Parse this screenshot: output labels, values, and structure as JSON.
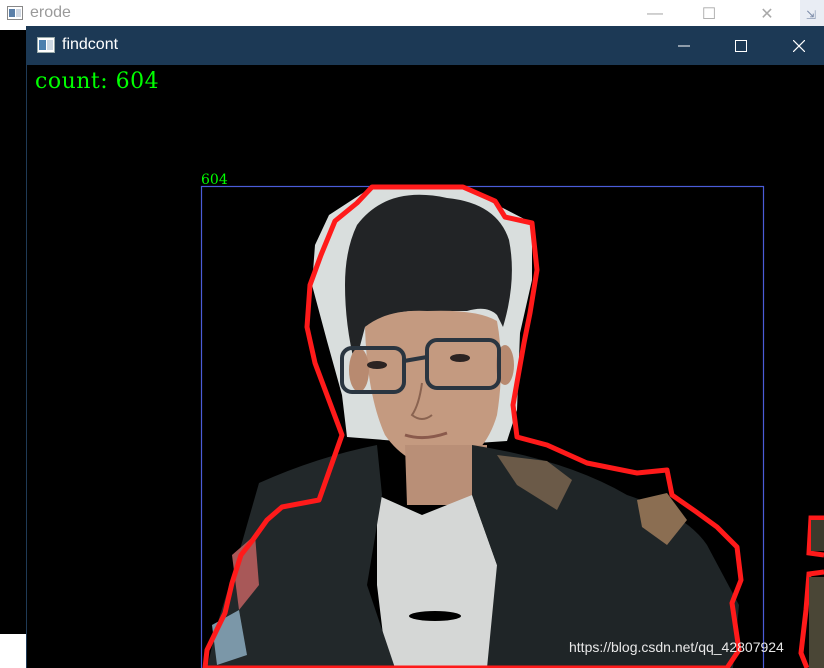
{
  "background_window": {
    "title": "erode",
    "controls": {
      "minimize": "—",
      "maximize": "☐",
      "close": "✕"
    }
  },
  "window": {
    "title": "findcont",
    "controls": {
      "minimize": "—",
      "maximize": "☐",
      "close": "✕"
    }
  },
  "overlay": {
    "count_text": "count: 604",
    "bbox_label": "604"
  },
  "watermark": "https://blog.csdn.net/qq_42807924",
  "colors": {
    "titlebar": "#1c3955",
    "overlay_text": "#00ff00",
    "contour": "#ff0000",
    "bounding_box": "#4a5cd8",
    "canvas": "#000000"
  }
}
